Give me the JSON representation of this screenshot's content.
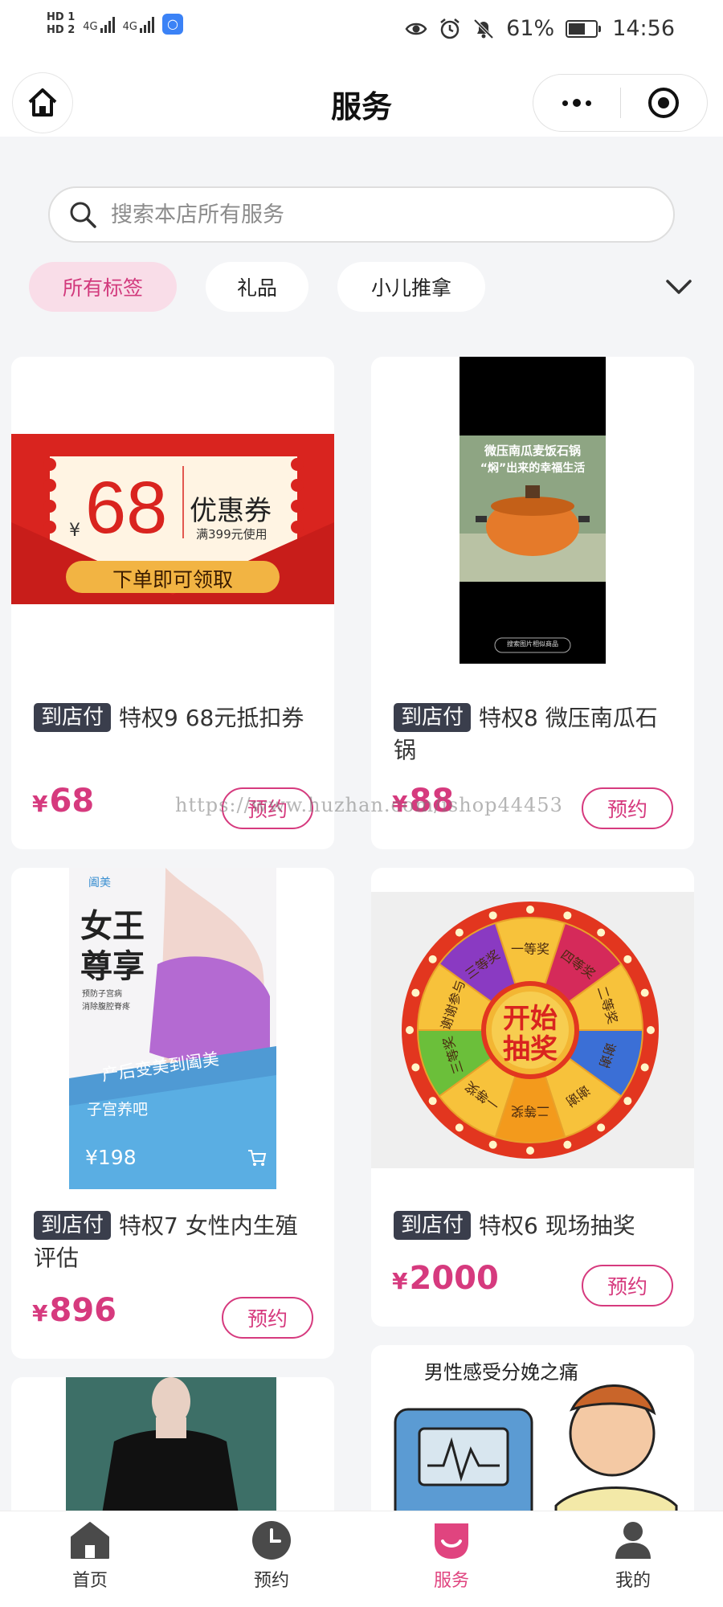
{
  "status_bar": {
    "hd1": "HD 1",
    "hd2": "HD 2",
    "net1": "4G",
    "net2": "4G",
    "battery_percent": "61%",
    "battery_level": 0.61,
    "time": "14:56",
    "icons": [
      "eye-icon",
      "alarm-icon",
      "bell-off-icon",
      "battery-icon"
    ]
  },
  "header": {
    "title": "服务",
    "home_icon": "home-icon",
    "menu_icon": "more-dots-icon",
    "close_icon": "target-icon"
  },
  "search": {
    "placeholder": "搜索本店所有服务",
    "value": ""
  },
  "tags": {
    "items": [
      {
        "label": "所有标签",
        "active": true
      },
      {
        "label": "礼品",
        "active": false
      },
      {
        "label": "小儿推拿",
        "active": false
      }
    ],
    "expand_icon": "chevron-down-icon"
  },
  "cards": [
    {
      "badge": "到店付",
      "title": "特权9 68元抵扣券",
      "currency": "¥",
      "price": "68",
      "button": "预约",
      "image": {
        "yen": "¥",
        "amount": "68",
        "coupon_text": "优惠券",
        "condition": "满399元使用",
        "cta": "下单即可领取"
      }
    },
    {
      "badge": "到店付",
      "title": "特权8 微压南瓜石锅",
      "currency": "¥",
      "price": "88",
      "button": "预约",
      "image": {
        "headline_1": "微压南瓜麦饭石锅",
        "headline_2": "“焖”出来的幸福生活",
        "search_hint": "搜索图片相似商品"
      }
    },
    {
      "badge": "到店付",
      "title": "特权7 女性内生殖评估",
      "currency": "¥",
      "price": "896",
      "button": "预约",
      "image": {
        "brand": "阖美",
        "headline_1": "女王",
        "headline_2": "尊享",
        "bullet_1": "预防子宫病",
        "bullet_2": "消除腹腔脊疼",
        "banner": "产后变美到阖美",
        "product": "子宫养吧",
        "price": "¥198"
      }
    },
    {
      "badge": "到店付",
      "title": "特权6 现场抽奖",
      "currency": "¥",
      "price": "2000",
      "button": "预约",
      "image": {
        "center_1": "开始",
        "center_2": "抽奖",
        "segments": [
          "一等奖",
          "四等奖",
          "二等奖",
          "谢谢",
          "谢谢",
          "二等奖",
          "一等奖",
          "三等奖",
          "谢谢参与",
          "三等奖"
        ]
      }
    },
    {
      "image": {
        "kind": "fashion-photo"
      }
    },
    {
      "image": {
        "caption": "男性感受分娩之痛"
      }
    }
  ],
  "watermark": "https://www.huzhan.com/ishop44453",
  "tabbar": {
    "items": [
      {
        "label": "首页",
        "icon": "home-tab-icon",
        "active": false
      },
      {
        "label": "预约",
        "icon": "clock-icon",
        "active": false
      },
      {
        "label": "服务",
        "icon": "service-icon",
        "active": true
      },
      {
        "label": "我的",
        "icon": "user-icon",
        "active": false
      }
    ],
    "active_color": "#e0447f"
  },
  "colors": {
    "accent": "#d63a7e",
    "badge_bg": "#3a3e4c",
    "active_tag_bg": "#f9dde8"
  }
}
